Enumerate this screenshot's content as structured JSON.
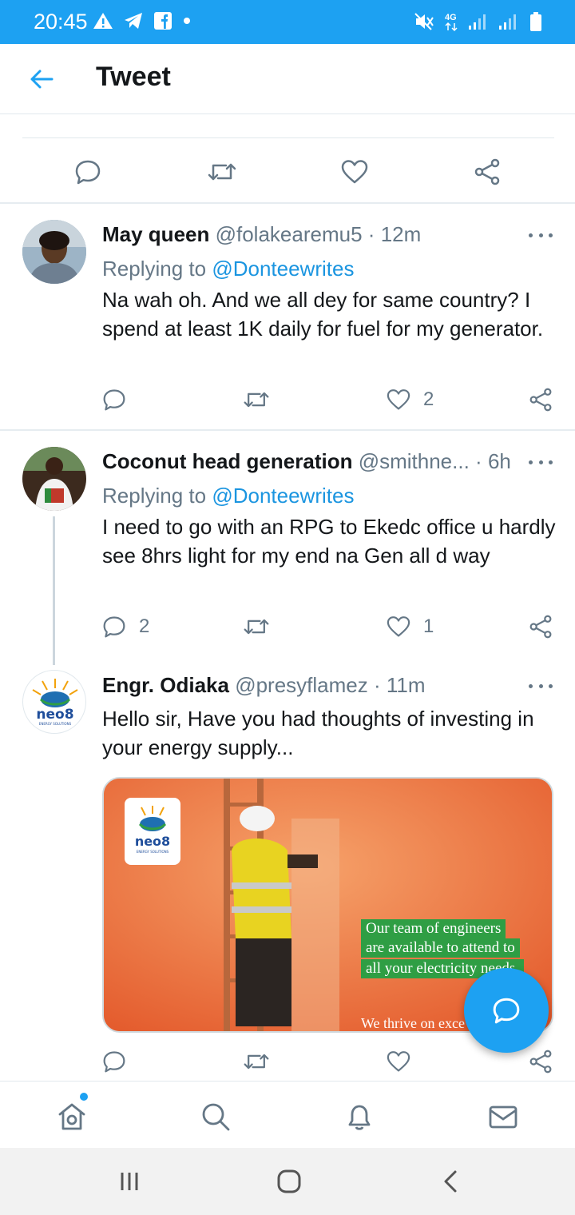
{
  "status_bar": {
    "time": "20:45",
    "left_icons": [
      "warning-icon",
      "telegram-icon",
      "facebook-icon",
      "dot-icon"
    ],
    "right_icons": [
      "mute-icon",
      "4g-icon",
      "signal-icon",
      "signal-icon-2",
      "battery-icon"
    ],
    "network_label": "4G",
    "color": "#1da1f2"
  },
  "header": {
    "title": "Tweet",
    "back_icon": "arrow-left-icon"
  },
  "main_tweet_actions": {
    "icons": [
      "reply-icon",
      "retweet-icon",
      "like-icon",
      "share-icon"
    ]
  },
  "tweets": [
    {
      "name": "May queen",
      "handle": "@folakearemu5",
      "separator": "·",
      "time": "12m",
      "replying_prefix": "Replying to",
      "replying_to": "@Donteewrites",
      "text": "Na wah oh. And we all dey for same country? I spend at least 1K daily for fuel for my generator.",
      "replies": "",
      "retweets": "",
      "likes": "2"
    },
    {
      "name": "Coconut head generation",
      "handle": "@smithne...",
      "separator": "·",
      "time": "6h",
      "replying_prefix": "Replying to",
      "replying_to": "@Donteewrites",
      "text": "I need to go with an RPG to Ekedc office u hardly see 8hrs light for my end na Gen all d way",
      "replies": "2",
      "retweets": "",
      "likes": "1"
    },
    {
      "name": "Engr. Odiaka",
      "handle": "@presyflamez",
      "separator": "·",
      "time": "11m",
      "text": "Hello sir, Have you had thoughts of investing in your energy supply...",
      "replies": "",
      "retweets": "",
      "likes": "",
      "card": {
        "logo_text": "neo8",
        "logo_sub": "ENERGY SOLUTIONS",
        "lines": [
          "Our team of engineers",
          "are available to attend to",
          "all your electricity needs."
        ],
        "bottom_text": "We thrive on exce"
      }
    }
  ],
  "avatar_logo": {
    "text": "neo8",
    "sub": "ENERGY SOLUTIONS"
  },
  "fab": {
    "icon": "compose-reply-icon"
  },
  "bottom_nav": {
    "items": [
      "home-icon",
      "search-icon",
      "notifications-icon",
      "messages-icon"
    ],
    "has_notification_dot": true
  },
  "system_nav": {
    "items": [
      "recent-apps-icon",
      "home-button-icon",
      "back-icon"
    ]
  },
  "colors": {
    "accent": "#1da1f2",
    "link": "#1b95e0",
    "muted": "#657786",
    "card_bg": "#e86a33",
    "card_tag": "#2f9e44"
  }
}
